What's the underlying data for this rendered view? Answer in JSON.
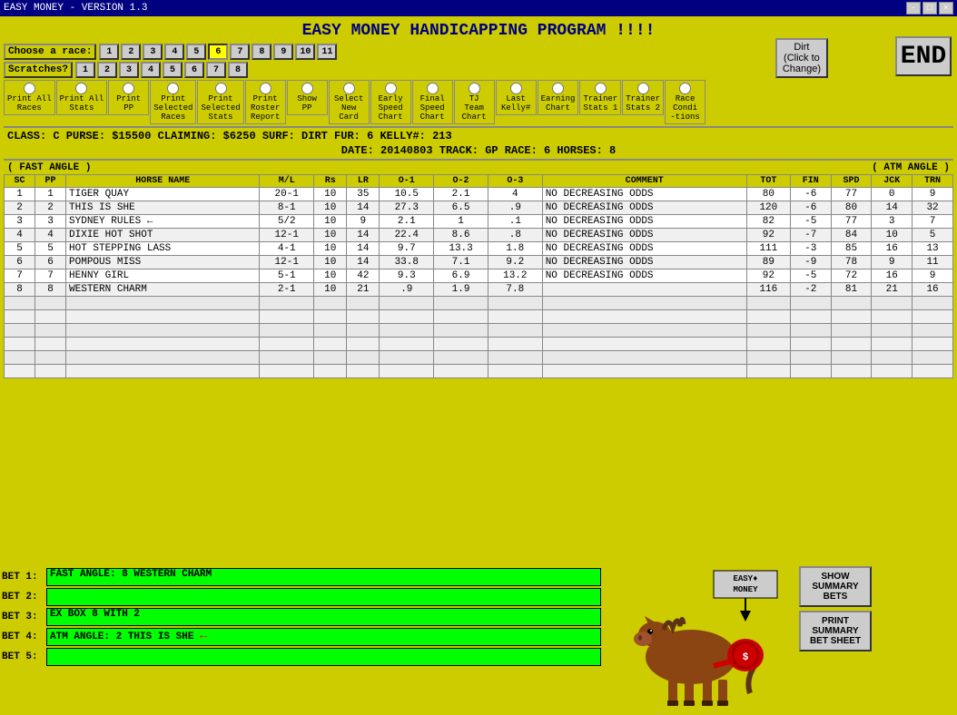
{
  "titleBar": {
    "title": "EASY MONEY - VERSION 1.3",
    "winControls": [
      "-",
      "□",
      "×"
    ]
  },
  "appTitle": "EASY MONEY HANDICAPPING PROGRAM !!!!",
  "topRightBtn": "Dirt (Click to Change)",
  "endBtn": "END",
  "chooseRace": {
    "label": "Choose a race:",
    "buttons": [
      "1",
      "2",
      "3",
      "4",
      "5",
      "6",
      "7",
      "8",
      "9",
      "10",
      "11"
    ],
    "selected": 6
  },
  "scratches": {
    "label": "Scratches?",
    "buttons": [
      "1",
      "2",
      "3",
      "4",
      "5",
      "6",
      "7",
      "8"
    ]
  },
  "toolbar": {
    "items": [
      {
        "type": "radio",
        "label": "Print All Races"
      },
      {
        "type": "radio",
        "label": "Print All Stats"
      },
      {
        "type": "radio",
        "label": "Print PP"
      },
      {
        "type": "radio",
        "label": "Print Selected Races"
      },
      {
        "type": "radio",
        "label": "Print Selected Stats"
      },
      {
        "type": "radio",
        "label": "Print Roster Report"
      },
      {
        "type": "radio",
        "label": "Show PP"
      },
      {
        "type": "radio",
        "label": "Select New Card"
      },
      {
        "type": "radio",
        "label": "Early Speed Chart"
      },
      {
        "type": "radio",
        "label": "Final Speed Chart"
      },
      {
        "type": "radio",
        "label": "TJ Team Chart"
      },
      {
        "type": "radio",
        "label": "Last Kelly#"
      },
      {
        "type": "radio",
        "label": "Earning Chart"
      },
      {
        "type": "radio",
        "label": "Trainer Stats 1"
      },
      {
        "type": "radio",
        "label": "Trainer Stats 2"
      },
      {
        "type": "radio",
        "label": "Race Conditions"
      }
    ]
  },
  "infoBar": {
    "line1": "CLASS:  C    PURSE: $15500   CLAIMING: $6250   SURF: DIRT   FUR: 6   KELLY#: 213",
    "line2": "DATE: 20140803      TRACK: GP       RACE: 6     HORSES: 8"
  },
  "angleHeader": {
    "left": "( FAST ANGLE )",
    "right": "( ATM ANGLE )"
  },
  "tableHeaders": [
    "SC",
    "PP",
    "HORSE NAME",
    "M/L",
    "Rs",
    "LR",
    "O-1",
    "O-2",
    "O-3",
    "COMMENT",
    "TOT",
    "FIN",
    "SPD",
    "JCK",
    "TRN"
  ],
  "tableRows": [
    {
      "sc": "1",
      "pp": "1",
      "name": "TIGER QUAY",
      "ml": "20-1",
      "rs": "10",
      "lr": "35",
      "o1": "10.5",
      "o2": "2.1",
      "o3": "4",
      "comment": "NO DECREASING ODDS",
      "tot": "80",
      "fin": "-6",
      "spd": "77",
      "jck": "0",
      "trn": "9",
      "arrow": false
    },
    {
      "sc": "2",
      "pp": "2",
      "name": "THIS IS SHE",
      "ml": "8-1",
      "rs": "10",
      "lr": "14",
      "o1": "27.3",
      "o2": "6.5",
      "o3": ".9",
      "comment": "NO DECREASING ODDS",
      "tot": "120",
      "fin": "-6",
      "spd": "80",
      "jck": "14",
      "trn": "32",
      "arrow": false
    },
    {
      "sc": "3",
      "pp": "3",
      "name": "SYDNEY RULES",
      "ml": "5/2",
      "rs": "10",
      "lr": "9",
      "o1": "2.1",
      "o2": "1",
      "o3": ".1",
      "comment": "NO DECREASING ODDS",
      "tot": "82",
      "fin": "-5",
      "spd": "77",
      "jck": "3",
      "trn": "7",
      "arrow": true
    },
    {
      "sc": "4",
      "pp": "4",
      "name": "DIXIE HOT SHOT",
      "ml": "12-1",
      "rs": "10",
      "lr": "14",
      "o1": "22.4",
      "o2": "8.6",
      "o3": ".8",
      "comment": "NO DECREASING ODDS",
      "tot": "92",
      "fin": "-7",
      "spd": "84",
      "jck": "10",
      "trn": "5",
      "arrow": false
    },
    {
      "sc": "5",
      "pp": "5",
      "name": "HOT STEPPING LASS",
      "ml": "4-1",
      "rs": "10",
      "lr": "14",
      "o1": "9.7",
      "o2": "13.3",
      "o3": "1.8",
      "comment": "NO DECREASING ODDS",
      "tot": "111",
      "fin": "-3",
      "spd": "85",
      "jck": "16",
      "trn": "13",
      "arrow": false
    },
    {
      "sc": "6",
      "pp": "6",
      "name": "POMPOUS MISS",
      "ml": "12-1",
      "rs": "10",
      "lr": "14",
      "o1": "33.8",
      "o2": "7.1",
      "o3": "9.2",
      "comment": "NO DECREASING ODDS",
      "tot": "89",
      "fin": "-9",
      "spd": "78",
      "jck": "9",
      "trn": "11",
      "arrow": false
    },
    {
      "sc": "7",
      "pp": "7",
      "name": "HENNY GIRL",
      "ml": "5-1",
      "rs": "10",
      "lr": "42",
      "o1": "9.3",
      "o2": "6.9",
      "o3": "13.2",
      "comment": "NO DECREASING ODDS",
      "tot": "92",
      "fin": "-5",
      "spd": "72",
      "jck": "16",
      "trn": "9",
      "arrow": false
    },
    {
      "sc": "8",
      "pp": "8",
      "name": "WESTERN CHARM",
      "ml": "2-1",
      "rs": "10",
      "lr": "21",
      "o1": ".9",
      "o2": "1.9",
      "o3": "7.8",
      "comment": "",
      "tot": "116",
      "fin": "-2",
      "spd": "81",
      "jck": "21",
      "trn": "16",
      "arrow": false
    }
  ],
  "emptyRows": 8,
  "bets": [
    {
      "label": "BET 1:",
      "value": "FAST ANGLE: 8     WESTERN CHARM",
      "filled": true
    },
    {
      "label": "BET 2:",
      "value": "",
      "filled": false
    },
    {
      "label": "BET 3:",
      "value": "EX BOX 8   WITH 2",
      "filled": true
    },
    {
      "label": "BET 4:",
      "value": "ATM ANGLE: 2    THIS IS SHE",
      "filled": true,
      "arrow": true
    },
    {
      "label": "BET 5:",
      "value": "",
      "filled": false
    }
  ],
  "rightButtons": [
    {
      "label": "SHOW\nSUMMARY\nBETS"
    },
    {
      "label": "PRINT\nSUMMARY\nBET SHEET"
    }
  ],
  "horseImage": {
    "title1": "EASY♦",
    "title2": "MONEY"
  }
}
